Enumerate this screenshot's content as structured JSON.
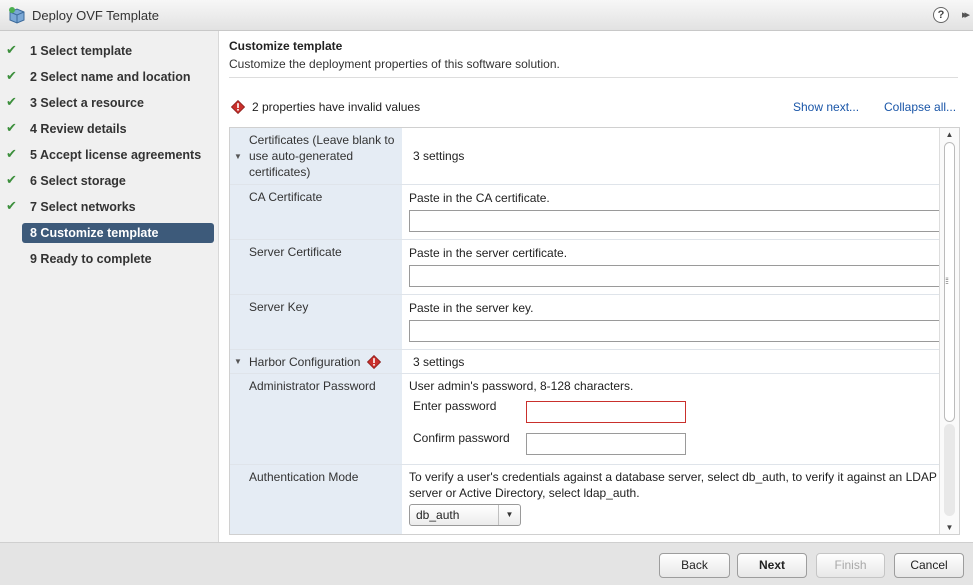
{
  "window": {
    "title": "Deploy OVF Template",
    "help_glyph": "?",
    "expand_glyph": "▸▸"
  },
  "steps": [
    {
      "label": "1  Select template",
      "done": true
    },
    {
      "label": "2  Select name and location",
      "done": true
    },
    {
      "label": "3  Select a resource",
      "done": true
    },
    {
      "label": "4  Review details",
      "done": true
    },
    {
      "label": "5  Accept license agreements",
      "done": true
    },
    {
      "label": "6  Select storage",
      "done": true
    },
    {
      "label": "7  Select networks",
      "done": true
    },
    {
      "label": "8  Customize template",
      "done": false,
      "active": true
    },
    {
      "label": "9  Ready to complete",
      "done": false
    }
  ],
  "check_glyph": "✔",
  "header": {
    "title": "Customize template",
    "subtitle": "Customize the deployment properties of this software solution."
  },
  "warning": {
    "text": "2 properties have invalid values",
    "show_next": "Show next...",
    "collapse_all": "Collapse all..."
  },
  "grid": {
    "certificates": {
      "label": "Certificates (Leave blank to use auto-generated certificates)",
      "value": "3 settings"
    },
    "ca_cert": {
      "label": "CA Certificate",
      "description": "Paste in the CA certificate.",
      "value": ""
    },
    "server_cert": {
      "label": "Server Certificate",
      "description": "Paste in the server certificate.",
      "value": ""
    },
    "server_key": {
      "label": "Server Key",
      "description": "Paste in the server key.",
      "value": ""
    },
    "harbor": {
      "label": "Harbor Configuration",
      "value": "3 settings"
    },
    "admin_pw": {
      "label": "Administrator Password",
      "description": "User admin's password, 8-128 characters.",
      "enter_label": "Enter password",
      "confirm_label": "Confirm password"
    },
    "auth_mode": {
      "label": "Authentication Mode",
      "description": "To verify a user's credentials against a database server, select db_auth, to verify it against an LDAP server or Active Directory, select ldap_auth.",
      "selected": "db_auth"
    }
  },
  "buttons": {
    "back": "Back",
    "next": "Next",
    "finish": "Finish",
    "cancel": "Cancel"
  },
  "colors": {
    "accent": "#3d5a7a",
    "link": "#1a56a8",
    "check": "#3c8f3c",
    "error": "#c9302c",
    "label_bg": "#e5ecf4"
  }
}
